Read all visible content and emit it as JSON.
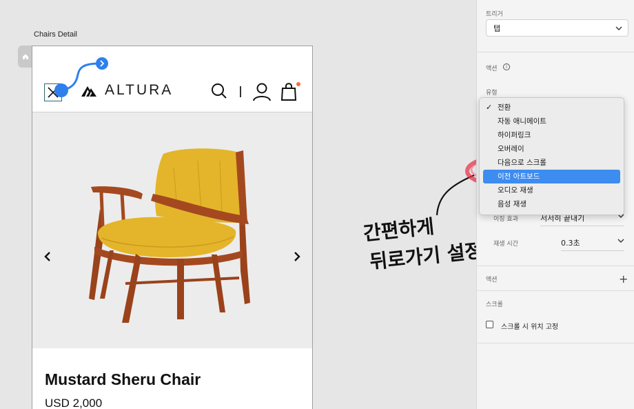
{
  "canvas": {
    "artboard_title": "Chairs Detail"
  },
  "site": {
    "logo_text": "ALTURA",
    "product_name": "Mustard Sheru Chair",
    "product_price": "USD 2,000"
  },
  "annotation": {
    "line1": "간편하게",
    "line2": "뒤로가기 설정"
  },
  "panel": {
    "trigger_label": "트리거",
    "trigger_value": "탭",
    "action_label": "액션",
    "type_label": "유형",
    "easing_label": "이징 효과",
    "easing_value": "서서히 끝내기",
    "duration_label": "재생 시간",
    "duration_value": "0.3초",
    "actions_section": "액션",
    "scroll_section": "스크롤",
    "scroll_fixed_label": "스크롤 시 위치 고정"
  },
  "menu": {
    "items": [
      {
        "label": "전환",
        "checked": true,
        "selected": false
      },
      {
        "label": "자동 애니메이트",
        "checked": false,
        "selected": false
      },
      {
        "label": "하이퍼링크",
        "checked": false,
        "selected": false
      },
      {
        "label": "오버레이",
        "checked": false,
        "selected": false
      },
      {
        "label": "다음으로 스크롤",
        "checked": false,
        "selected": false
      },
      {
        "label": "이전 아트보드",
        "checked": false,
        "selected": true
      },
      {
        "label": "오디오 재생",
        "checked": false,
        "selected": false
      },
      {
        "label": "음성 재생",
        "checked": false,
        "selected": false
      }
    ]
  },
  "colors": {
    "accent": "#3d8cf0",
    "connector": "#2f7fec",
    "cart_badge": "#ff6a3d",
    "chair_yellow": "#e4b52a",
    "chair_wood": "#a4491f",
    "scribble_red": "#e8354b"
  },
  "icons": [
    "home-icon",
    "close-icon",
    "logo-mark-icon",
    "search-icon",
    "user-icon",
    "bag-icon",
    "chevron-left-icon",
    "chevron-right-icon",
    "chevron-down-icon",
    "info-icon",
    "plus-icon",
    "checkmark-icon"
  ]
}
